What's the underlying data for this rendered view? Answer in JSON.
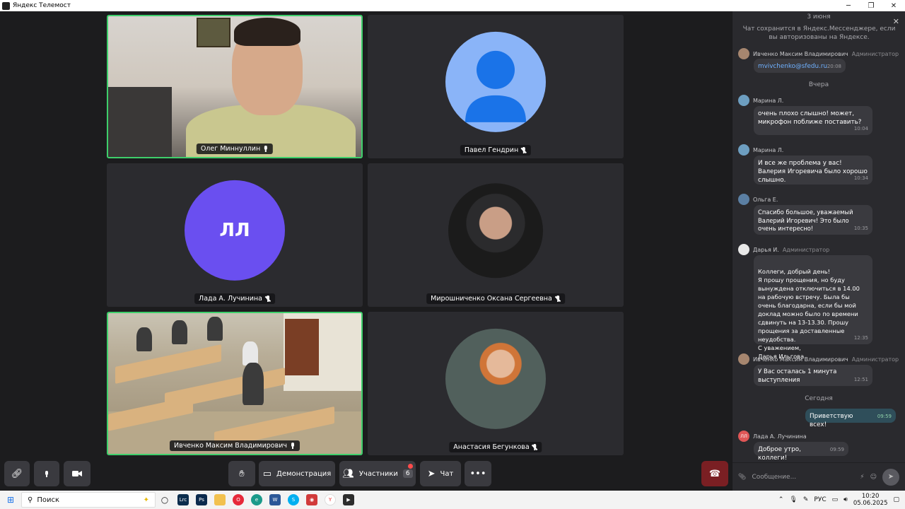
{
  "window": {
    "title": "Яндекс Телемост"
  },
  "tiles": [
    {
      "name": "Олег Миннуллин",
      "mic": "on"
    },
    {
      "name": "Павел Гендрин",
      "mic": "off"
    },
    {
      "name": "Лада А. Лучинина",
      "mic": "off",
      "initials": "ЛЛ"
    },
    {
      "name": "Мирошниченко Оксана Сергеевна",
      "mic": "off"
    },
    {
      "name": "Ивченко Максим Владимирович",
      "mic": "on"
    },
    {
      "name": "Анастасия Бегункова",
      "mic": "off"
    }
  ],
  "colors": {
    "active_border": "#3ecf6b",
    "avatar_blue": "#8ab4f8",
    "avatar_purple": "#6a4ff0",
    "hangup": "#7a1f23"
  },
  "chat": {
    "day1": "3 июня",
    "notice": "Чат сохранится в Яндекс.Мессенджере, если вы авторизованы на Яндексе.",
    "day2": "Вчера",
    "day3": "Сегодня",
    "messages": [
      {
        "author": "Ивченко Максим Владимирович",
        "role": "Администратор",
        "text": "mvivchenko@sfedu.ru",
        "time": "20:08"
      },
      {
        "author": "Марина Л.",
        "role": "",
        "text": "очень плохо слышно! может, микрофон поближе поставить?",
        "time": "10:04"
      },
      {
        "author": "Марина Л.",
        "role": "",
        "text": "И все же проблема у вас! Валерия Игоревича было хорошо слышно.",
        "time": "10:34"
      },
      {
        "author": "Ольга Е.",
        "role": "",
        "text": "Спасибо большое, уважаемый Валерий Игоревич! Это было очень интересно!",
        "time": "10:35"
      },
      {
        "author": "Дарья И.",
        "role": "Администратор",
        "text": "Коллеги, добрый день!\nЯ прошу прощения, но буду вынуждена отключиться в 14.00 на рабочую встречу. Была бы очень благодарна, если бы мой доклад можно было по времени сдвинуть на 13-13.30. Прошу прощения за доставленные неудобства.\nС уважением,\nДарья Ильгова",
        "time": "12:35"
      },
      {
        "author": "Ивченко Максим Владимирович",
        "role": "Администратор",
        "text": "У Вас осталась 1 минута выступления",
        "time": "12:51"
      },
      {
        "author": "",
        "role": "",
        "text": "Приветствую всех!",
        "time": "09:59"
      },
      {
        "author": "Лада А. Лучинина",
        "role": "",
        "text": "Доброе утро, коллеги!",
        "time": "09:59",
        "initials": "ЛЛ"
      }
    ],
    "input_placeholder": "Сообщение..."
  },
  "toolbar": {
    "demo_label": "Демонстрация",
    "participants_label": "Участники",
    "participants_count": "6",
    "chat_label": "Чат"
  },
  "taskbar": {
    "search_label": "Поиск",
    "lang": "РУС",
    "time": "10:20",
    "date": "05.06.2025"
  }
}
